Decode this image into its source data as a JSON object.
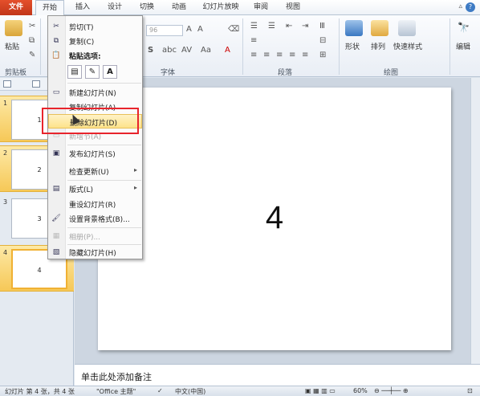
{
  "tabs": {
    "file": "文件",
    "home": "开始",
    "insert": "插入",
    "design": "设计",
    "transition": "切换",
    "animation": "动画",
    "slideshow": "幻灯片放映",
    "review": "审阅",
    "view": "视图"
  },
  "ribbon": {
    "paste": "粘贴",
    "clipboard_group": "剪贴板",
    "font_group": "字体",
    "paragraph_group": "段落",
    "drawing_group": "绘图",
    "font_size": "96",
    "shape": "形状",
    "arrange": "排列",
    "quick_styles": "快速样式",
    "edit": "编辑"
  },
  "context_menu": {
    "cut": "剪切(T)",
    "copy": "复制(C)",
    "paste_options": "粘贴选项:",
    "new_slide": "新建幻灯片(N)",
    "duplicate_slide": "复制幻灯片(A)",
    "delete_slide": "删除幻灯片(D)",
    "new_section": "新增节(A)",
    "publish_slides": "发布幻灯片(S)",
    "check_updates": "检查更新(U)",
    "layout": "版式(L)",
    "reset_slide": "重设幻灯片(R)",
    "format_background": "设置背景格式(B)...",
    "photo_album": "相册(P)...",
    "hide_slide": "隐藏幻灯片(H)"
  },
  "slides": [
    {
      "num": "1",
      "label": "1"
    },
    {
      "num": "2",
      "label": "2"
    },
    {
      "num": "3",
      "label": "3"
    },
    {
      "num": "4",
      "label": "4"
    }
  ],
  "slide": {
    "content": "4"
  },
  "notes_placeholder": "单击此处添加备注",
  "status": {
    "slide_info": "幻灯片 第 4 张，共 4 张",
    "theme": "\"Office 主题\"",
    "language": "中文(中国)",
    "zoom": "60%"
  },
  "colors": {
    "file_tab": "#c2361a",
    "highlight": "#fde28a",
    "annotation": "#e8242c"
  }
}
